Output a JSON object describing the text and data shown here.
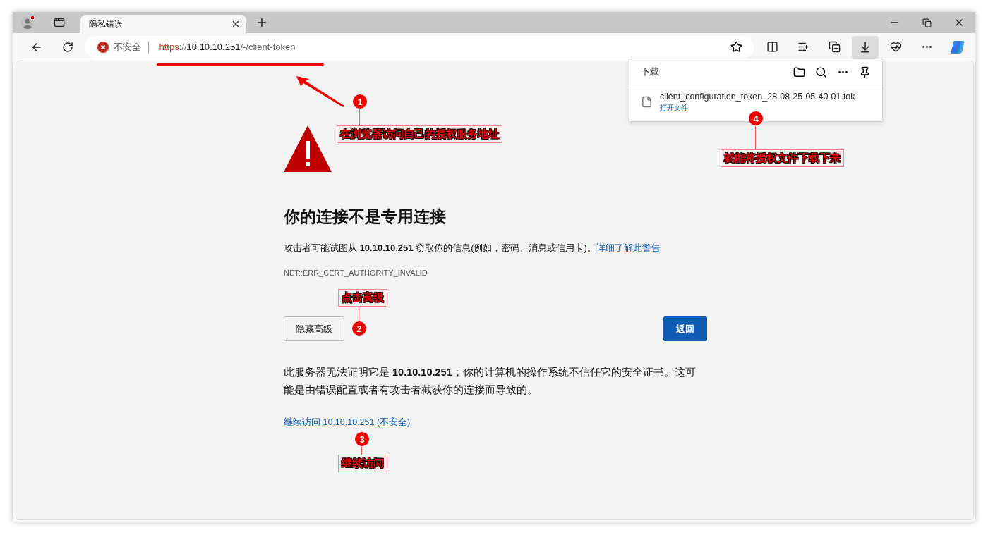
{
  "tab": {
    "title": "隐私错误",
    "selected": true
  },
  "address_bar": {
    "security": "不安全",
    "scheme": "https",
    "separator": "://",
    "host": "10.10.10.251",
    "path": "/-/client-token"
  },
  "toolbar": {
    "downloads_active": true
  },
  "downloads": {
    "title": "下载",
    "file_name": "client_configuration_token_28-08-25-05-40-01.tok",
    "open_link": "打开文件"
  },
  "error_page": {
    "heading": "你的连接不是专用连接",
    "description": "攻击者可能试图从 **10.10.10.251** 窃取你的信息(例如，密码、消息或信用卡)。",
    "learn_more": "详细了解此警告",
    "error_code": "NET::ERR_CERT_AUTHORITY_INVALID",
    "buttons": [
      {
        "label": "隐藏高级",
        "kind": "secondary"
      },
      {
        "label": "返回",
        "kind": "primary"
      }
    ],
    "details": "此服务器无法证明它是 **10.10.10.251**；你的计算机的操作系统不信任它的安全证书。这可能是由错误配置或者有攻击者截获你的连接而导致的。",
    "proceed_link": "继续访问 10.10.10.251 (不安全)"
  },
  "annotations": [
    {
      "number": "1",
      "text": "在浏览器访问自己的授权服务地址",
      "kind": "arrow"
    },
    {
      "number": "2",
      "text": "点击高级",
      "kind": "pin"
    },
    {
      "number": "3",
      "text": "继续访问",
      "kind": "pin"
    },
    {
      "number": "4",
      "text": "就能将授权文件下载下来",
      "kind": "pin"
    }
  ]
}
